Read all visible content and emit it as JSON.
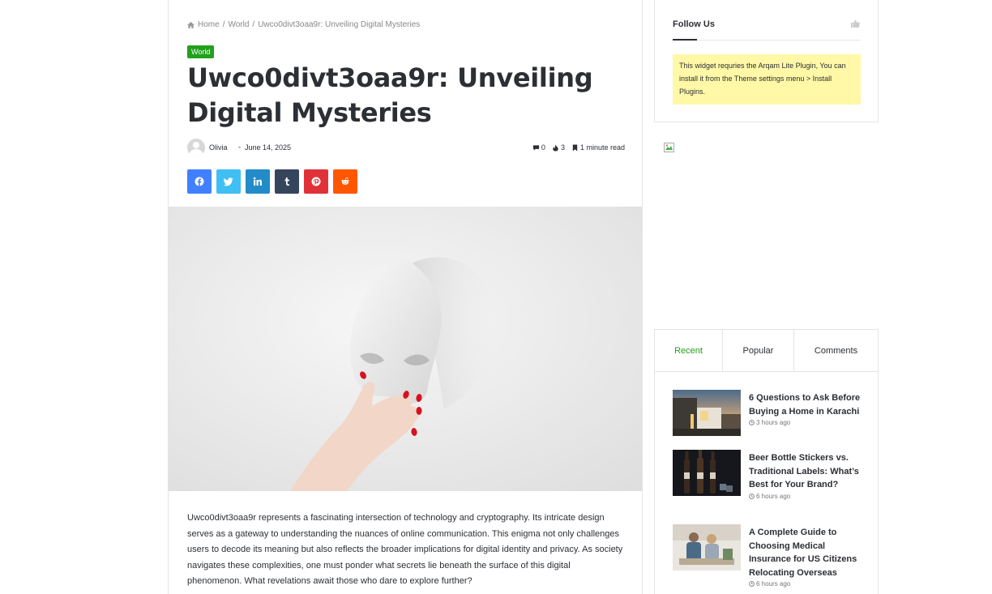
{
  "breadcrumb": {
    "home": "Home",
    "sep1": "/",
    "section": "World",
    "sep2": "/",
    "current": "Uwco0divt3oaa9r: Unveiling Digital Mysteries"
  },
  "article": {
    "category": "World",
    "title": "Uwco0divt3oaa9r: Unveiling Digital Mysteries",
    "author": "Olivia",
    "date": "June 14, 2025",
    "comments": "0",
    "views": "3",
    "read_time": "1 minute read",
    "body": "Uwco0divt3oaa9r represents a fascinating intersection of technology and cryptography. Its intricate design serves as a gateway to understanding the nuances of online communication. This enigma not only challenges users to decode its meaning but also reflects the broader implications for digital identity and privacy. As society navigates these complexities, one must ponder what secrets lie beneath the surface of this digital phenomenon. What revelations await those who dare to explore further?"
  },
  "share_buttons": [
    {
      "network": "facebook",
      "icon": "facebook-icon",
      "color": "#4080ff"
    },
    {
      "network": "twitter",
      "icon": "twitter-icon",
      "color": "#40bff5"
    },
    {
      "network": "linkedin",
      "icon": "linkedin-icon",
      "color": "#238cc8"
    },
    {
      "network": "tumblr",
      "icon": "tumblr-icon",
      "color": "#35465c"
    },
    {
      "network": "pinterest",
      "icon": "pinterest-icon",
      "color": "#e13138"
    },
    {
      "network": "reddit",
      "icon": "reddit-icon",
      "color": "#ff5700"
    }
  ],
  "sidebar": {
    "follow_title": "Follow Us",
    "follow_notice": "This widget requries the Arqam Lite Plugin, You can install it from the Theme settings menu > Install Plugins.",
    "tabs": [
      "Recent",
      "Popular",
      "Comments"
    ],
    "active_tab": "Recent",
    "posts": [
      {
        "title": "6 Questions to Ask Before Buying a Home in Karachi",
        "time": "3 hours ago"
      },
      {
        "title": "Beer Bottle Stickers vs. Traditional Labels: What’s Best for Your Brand?",
        "time": "6 hours ago"
      },
      {
        "title": "A Complete Guide to Choosing Medical Insurance for US Citizens Relocating Overseas",
        "time": "6 hours ago"
      }
    ]
  },
  "colors": {
    "accent": "#22a01c",
    "notice_bg": "#fff8a6",
    "text": "#2c2f34"
  }
}
